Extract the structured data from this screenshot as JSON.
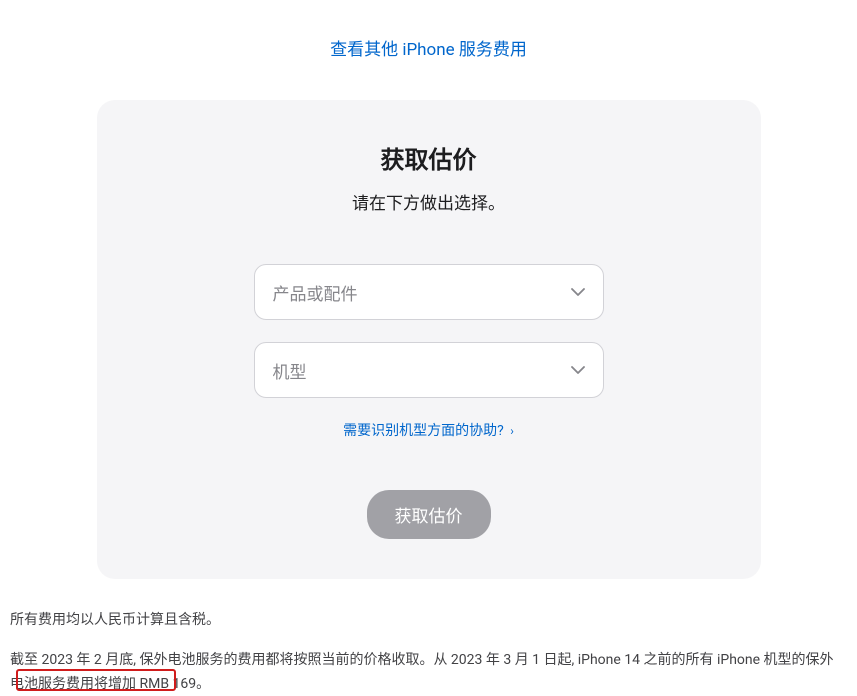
{
  "topLink": "查看其他 iPhone 服务费用",
  "card": {
    "title": "获取估价",
    "subtitle": "请在下方做出选择。",
    "select1": {
      "placeholder": "产品或配件"
    },
    "select2": {
      "placeholder": "机型"
    },
    "helpLink": "需要识别机型方面的协助? ",
    "button": "获取估价"
  },
  "footer": {
    "line1": "所有费用均以人民币计算且含税。",
    "line2_part1": "截至 2023 年 2 月底, 保外电池服务的费用都将按照当前的价格收取。从 2023 年 3 月 1 日起, iPhone 14 之前的所有 iPhone 机型的保外电池服务",
    "line2_part2": "费用将增加 RMB 169。"
  }
}
